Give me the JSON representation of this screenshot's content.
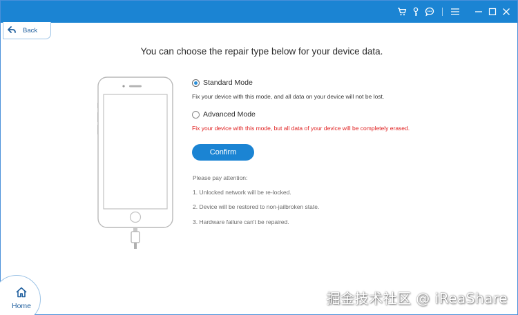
{
  "nav": {
    "back_label": "Back",
    "home_label": "Home"
  },
  "heading": "You can choose the repair type below for your device data.",
  "options": [
    {
      "label": "Standard Mode",
      "checked": true,
      "description": "Fix your device with this mode, and all data on your device will not be lost."
    },
    {
      "label": "Advanced Mode",
      "checked": false,
      "description": "Fix your device with this mode, but all data of your device will be completely erased."
    }
  ],
  "confirm_label": "Confirm",
  "attention": {
    "title": "Please pay attention:",
    "notes": [
      "1. Unlocked network will be re-locked.",
      "2. Device will be restored to non-jailbroken state.",
      "3. Hardware failure can't be repaired."
    ]
  },
  "titlebar_icons": [
    "cart-icon",
    "key-icon",
    "chat-icon",
    "menu-icon",
    "minimize-icon",
    "maximize-icon",
    "close-icon"
  ],
  "watermark": "掘金技术社区 @ iReaShare",
  "colors": {
    "accent": "#1b84d3",
    "warning": "#e02020",
    "border": "#9cc3e6"
  }
}
